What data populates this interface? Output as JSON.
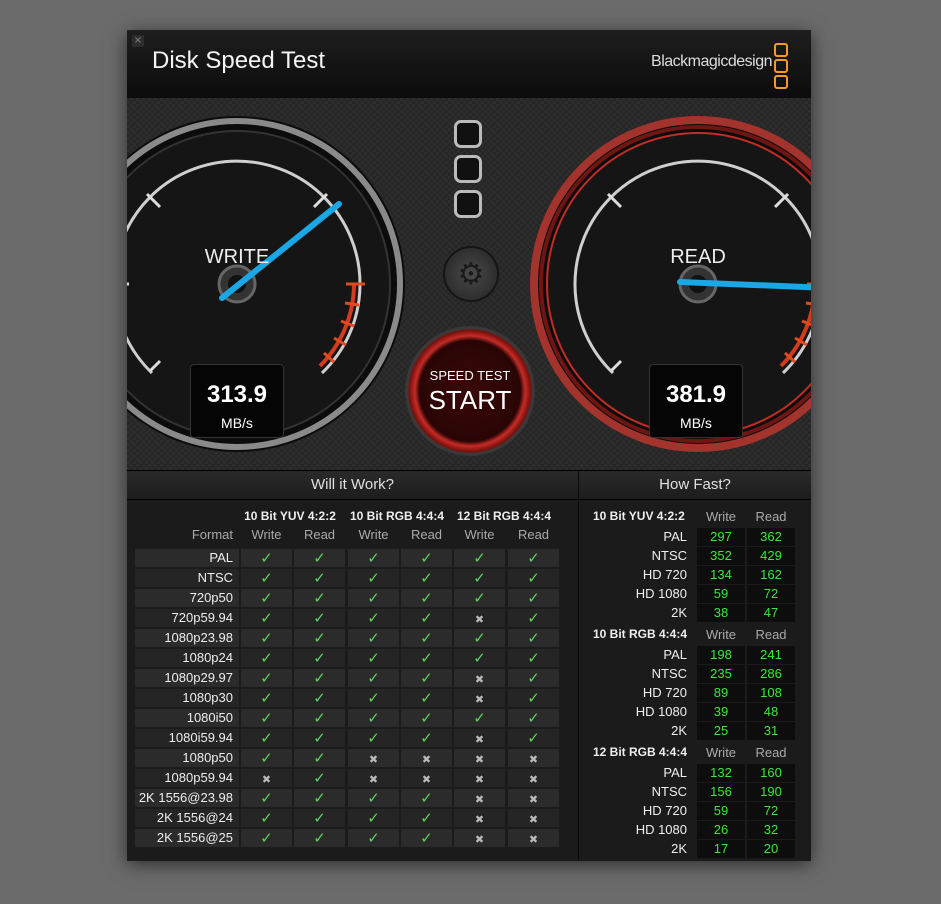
{
  "window": {
    "title": "Disk Speed Test",
    "brand": "Blackmagicdesign",
    "close_symbol": "×"
  },
  "write_gauge": {
    "label": "WRITE",
    "value": "313.9",
    "unit": "MB/s"
  },
  "read_gauge": {
    "label": "READ",
    "value": "381.9",
    "unit": "MB/s"
  },
  "start_button": {
    "line1": "SPEED TEST",
    "line2": "START"
  },
  "colors": {
    "accent": "#f29a27",
    "needle": "#1aa7e6",
    "pass": "#5fd25f",
    "value_green": "#3be83b",
    "red_ring": "#c42c26"
  },
  "will_it_work": {
    "title": "Will it Work?",
    "format_label": "Format",
    "groups": [
      "10 Bit YUV 4:2:2",
      "10 Bit RGB 4:4:4",
      "12 Bit RGB 4:4:4"
    ],
    "subheaders": [
      "Write",
      "Read",
      "Write",
      "Read",
      "Write",
      "Read"
    ],
    "rows": [
      {
        "format": "PAL",
        "checks": [
          true,
          true,
          true,
          true,
          true,
          true
        ]
      },
      {
        "format": "NTSC",
        "checks": [
          true,
          true,
          true,
          true,
          true,
          true
        ]
      },
      {
        "format": "720p50",
        "checks": [
          true,
          true,
          true,
          true,
          true,
          true
        ]
      },
      {
        "format": "720p59.94",
        "checks": [
          true,
          true,
          true,
          true,
          false,
          true
        ]
      },
      {
        "format": "1080p23.98",
        "checks": [
          true,
          true,
          true,
          true,
          true,
          true
        ]
      },
      {
        "format": "1080p24",
        "checks": [
          true,
          true,
          true,
          true,
          true,
          true
        ]
      },
      {
        "format": "1080p29.97",
        "checks": [
          true,
          true,
          true,
          true,
          false,
          true
        ]
      },
      {
        "format": "1080p30",
        "checks": [
          true,
          true,
          true,
          true,
          false,
          true
        ]
      },
      {
        "format": "1080i50",
        "checks": [
          true,
          true,
          true,
          true,
          true,
          true
        ]
      },
      {
        "format": "1080i59.94",
        "checks": [
          true,
          true,
          true,
          true,
          false,
          true
        ]
      },
      {
        "format": "1080p50",
        "checks": [
          true,
          true,
          false,
          false,
          false,
          false
        ]
      },
      {
        "format": "1080p59.94",
        "checks": [
          false,
          true,
          false,
          false,
          false,
          false
        ]
      },
      {
        "format": "2K 1556@23.98",
        "checks": [
          true,
          true,
          true,
          true,
          false,
          false
        ]
      },
      {
        "format": "2K 1556@24",
        "checks": [
          true,
          true,
          true,
          true,
          false,
          false
        ]
      },
      {
        "format": "2K 1556@25",
        "checks": [
          true,
          true,
          true,
          true,
          false,
          false
        ]
      }
    ]
  },
  "how_fast": {
    "title": "How Fast?",
    "groups": [
      {
        "name": "10 Bit YUV 4:2:2",
        "write_label": "Write",
        "read_label": "Read",
        "rows": [
          {
            "format": "PAL",
            "write": "297",
            "read": "362"
          },
          {
            "format": "NTSC",
            "write": "352",
            "read": "429"
          },
          {
            "format": "HD 720",
            "write": "134",
            "read": "162"
          },
          {
            "format": "HD 1080",
            "write": "59",
            "read": "72"
          },
          {
            "format": "2K",
            "write": "38",
            "read": "47"
          }
        ]
      },
      {
        "name": "10 Bit RGB 4:4:4",
        "write_label": "Write",
        "read_label": "Read",
        "rows": [
          {
            "format": "PAL",
            "write": "198",
            "read": "241"
          },
          {
            "format": "NTSC",
            "write": "235",
            "read": "286"
          },
          {
            "format": "HD 720",
            "write": "89",
            "read": "108"
          },
          {
            "format": "HD 1080",
            "write": "39",
            "read": "48"
          },
          {
            "format": "2K",
            "write": "25",
            "read": "31"
          }
        ]
      },
      {
        "name": "12 Bit RGB 4:4:4",
        "write_label": "Write",
        "read_label": "Read",
        "rows": [
          {
            "format": "PAL",
            "write": "132",
            "read": "160"
          },
          {
            "format": "NTSC",
            "write": "156",
            "read": "190"
          },
          {
            "format": "HD 720",
            "write": "59",
            "read": "72"
          },
          {
            "format": "HD 1080",
            "write": "26",
            "read": "32"
          },
          {
            "format": "2K",
            "write": "17",
            "read": "20"
          }
        ]
      }
    ]
  }
}
